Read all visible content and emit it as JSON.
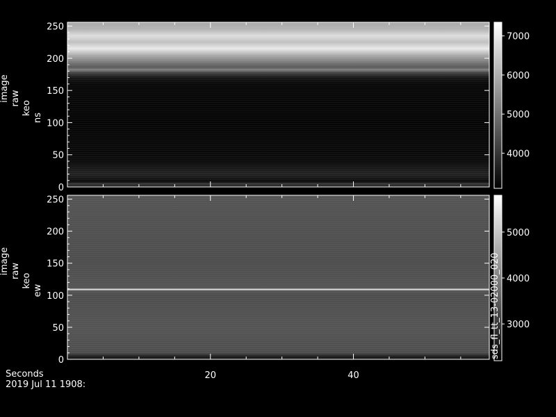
{
  "chart_data": [
    {
      "type": "heatmap",
      "panel": "ns",
      "ylabel_lines": [
        "image",
        "raw",
        "keo",
        "ns"
      ],
      "ylim": [
        0,
        256
      ],
      "yticks": [
        "0",
        "50",
        "100",
        "150",
        "200",
        "250"
      ],
      "colorbar_ticks": [
        "4000",
        "5000",
        "6000",
        "7000"
      ],
      "colorbar_range": [
        3100,
        7350
      ],
      "row_profile": [
        {
          "y": 0,
          "v": 3500
        },
        {
          "y": 5,
          "v": 4100
        },
        {
          "y": 8,
          "v": 3300
        },
        {
          "y": 20,
          "v": 3700
        },
        {
          "y": 40,
          "v": 3300
        },
        {
          "y": 100,
          "v": 3200
        },
        {
          "y": 160,
          "v": 3250
        },
        {
          "y": 170,
          "v": 3500
        },
        {
          "y": 178,
          "v": 4300
        },
        {
          "y": 182,
          "v": 5300
        },
        {
          "y": 186,
          "v": 4600
        },
        {
          "y": 192,
          "v": 5000
        },
        {
          "y": 205,
          "v": 6000
        },
        {
          "y": 215,
          "v": 7000
        },
        {
          "y": 225,
          "v": 6300
        },
        {
          "y": 235,
          "v": 6800
        },
        {
          "y": 245,
          "v": 6100
        },
        {
          "y": 256,
          "v": 5900
        }
      ]
    },
    {
      "type": "heatmap",
      "panel": "ew",
      "ylabel_lines": [
        "image",
        "raw",
        "keo",
        "ew"
      ],
      "ylim": [
        0,
        256
      ],
      "yticks": [
        "0",
        "50",
        "100",
        "150",
        "200",
        "250"
      ],
      "colorbar_ticks": [
        "3000",
        "4000",
        "5000"
      ],
      "colorbar_range": [
        2200,
        5800
      ],
      "colorbar_annotation": "sds_fl_tt_13-02000_020",
      "row_profile": [
        {
          "y": 0,
          "v": 2500
        },
        {
          "y": 4,
          "v": 2600
        },
        {
          "y": 10,
          "v": 3300
        },
        {
          "y": 50,
          "v": 3400
        },
        {
          "y": 100,
          "v": 3300
        },
        {
          "y": 107,
          "v": 3400
        },
        {
          "y": 109,
          "v": 5600
        },
        {
          "y": 111,
          "v": 3400
        },
        {
          "y": 150,
          "v": 3300
        },
        {
          "y": 200,
          "v": 3350
        },
        {
          "y": 256,
          "v": 3400
        }
      ]
    }
  ],
  "xaxis": {
    "label": "Seconds",
    "xlim": [
      0,
      59
    ],
    "ticks": [
      "20",
      "40"
    ],
    "tick_values": [
      20,
      40
    ]
  },
  "footer": {
    "date": "2019 Jul 11 1908:"
  }
}
